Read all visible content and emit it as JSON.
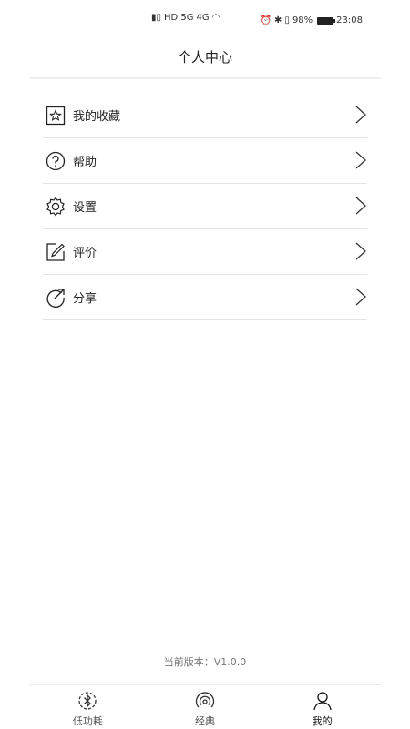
{
  "status_bar": {
    "network_left": "HD 5G",
    "network_right": "4G",
    "battery": "98%",
    "time": "23:08"
  },
  "header": {
    "title": "个人中心"
  },
  "menu": {
    "items": [
      {
        "label": "我的收藏",
        "icon": "star-box-icon"
      },
      {
        "label": "帮助",
        "icon": "help-circle-icon"
      },
      {
        "label": "设置",
        "icon": "gear-icon"
      },
      {
        "label": "评价",
        "icon": "edit-icon"
      },
      {
        "label": "分享",
        "icon": "share-icon"
      }
    ]
  },
  "footer": {
    "version": "当前版本：V1.0.0"
  },
  "tabs": [
    {
      "label": "低功耗",
      "icon": "bluetooth-icon"
    },
    {
      "label": "经典",
      "icon": "signal-icon"
    },
    {
      "label": "我的",
      "icon": "user-icon",
      "active": true
    }
  ],
  "colors": {
    "text": "#222222",
    "divider": "#e4e4e4",
    "muted": "#777777"
  }
}
